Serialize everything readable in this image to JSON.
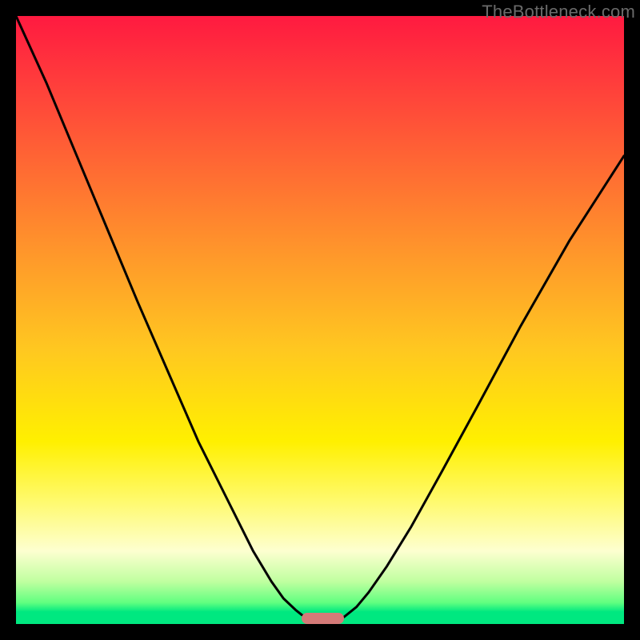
{
  "watermark": "TheBottleneck.com",
  "chart_data": {
    "type": "line",
    "title": "",
    "xlabel": "",
    "ylabel": "",
    "xlim": [
      0,
      100
    ],
    "ylim": [
      0,
      100
    ],
    "grid": false,
    "legend": false,
    "series": [
      {
        "name": "left-curve",
        "x": [
          0,
          5,
          10,
          15,
          20,
          25,
          30,
          35,
          39,
          42,
          44,
          46,
          47,
          48,
          49,
          50
        ],
        "values": [
          100,
          89,
          77,
          65,
          53,
          41.5,
          30,
          20,
          12,
          7,
          4.2,
          2.3,
          1.5,
          1.0,
          0.6,
          0.3
        ]
      },
      {
        "name": "right-curve",
        "x": [
          52,
          53,
          54,
          56,
          58,
          61,
          65,
          70,
          76,
          83,
          91,
          100
        ],
        "values": [
          0.3,
          0.6,
          1.2,
          2.8,
          5.2,
          9.5,
          16,
          25,
          36,
          49,
          63,
          77
        ]
      }
    ],
    "valley_marker": {
      "x_start": 47,
      "x_end": 54,
      "y": 0
    },
    "background_gradient": {
      "top": "#ff1a40",
      "mid": "#fff000",
      "bottom": "#00e880"
    }
  }
}
